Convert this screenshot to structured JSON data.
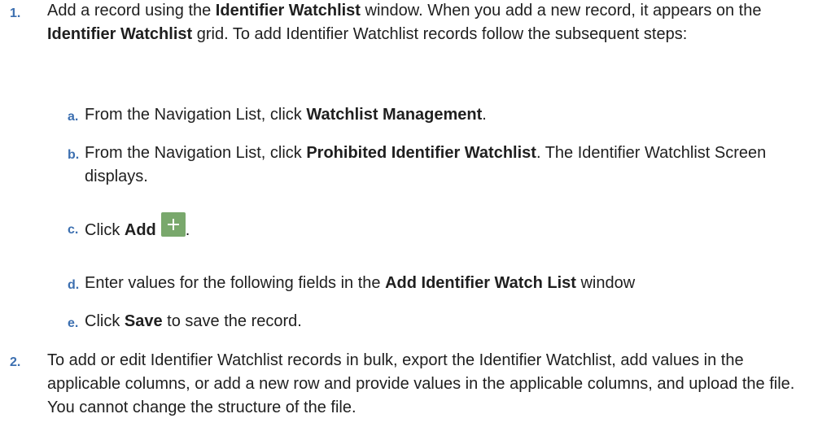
{
  "step1": {
    "number": "1.",
    "text_a": "Add a record using the ",
    "bold_a": "Identifier Watchlist",
    "text_b": " window. When you add a new record, it appears on the ",
    "bold_b": "Identifier Watchlist",
    "text_c": " grid. To add Identifier Watchlist records follow the subsequent steps:",
    "substeps": {
      "a": {
        "letter": "a.",
        "text": "From the Navigation List, click ",
        "bold": "Watchlist Management",
        "end": "."
      },
      "b": {
        "letter": "b.",
        "text": "From the Navigation List, click ",
        "bold": "Prohibited Identifier Watchlist",
        "end": ". The Identifier Watchlist Screen displays."
      },
      "c": {
        "letter": "c.",
        "text": "Click ",
        "bold": "Add",
        "icon": "plus-icon",
        "icon_color": "#79a86c",
        "end": "."
      },
      "d": {
        "letter": "d.",
        "text": "Enter values for the following fields in the ",
        "bold": "Add Identifier Watch List",
        "end": " window"
      },
      "e": {
        "letter": "e.",
        "text": "Click ",
        "bold": "Save",
        "end": " to save the record."
      }
    }
  },
  "step2": {
    "number": "2.",
    "text": "To add or edit Identifier Watchlist records in bulk, export the Identifier Watchlist, add values in the applicable columns, or add a new row and provide values in the applicable columns, and upload the file. You cannot change the structure of the file."
  },
  "colors": {
    "number": "#3c6fb0",
    "text": "#1f1f1f"
  }
}
